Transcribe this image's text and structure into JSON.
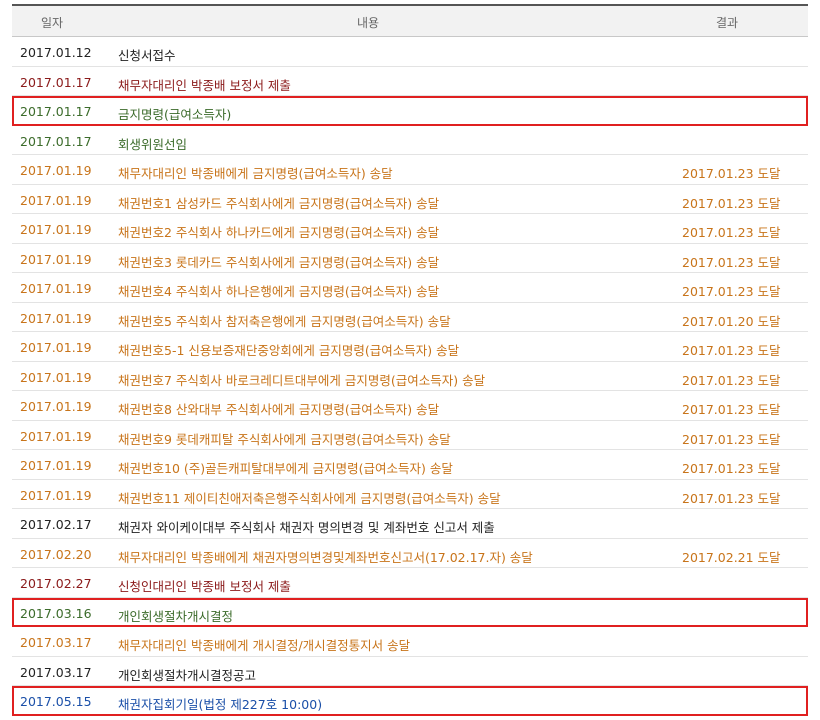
{
  "table": {
    "headers": {
      "date": "일자",
      "content": "내용",
      "result": "결과"
    },
    "colors": {
      "black": "#222222",
      "maroon": "#8b1a1a",
      "green": "#3b6b2a",
      "orange": "#c8741a",
      "blue": "#1a4fa8",
      "highlight_border": "#e02020"
    },
    "rows": [
      {
        "date": "2017.01.12",
        "content": "신청서접수",
        "result": "",
        "color": "#222222",
        "boxed": false
      },
      {
        "date": "2017.01.17",
        "content": "채무자대리인 박종배 보정서 제출",
        "result": "",
        "color": "#8b1a1a",
        "boxed": false
      },
      {
        "date": "2017.01.17",
        "content": "금지명령(급여소득자)",
        "result": "",
        "color": "#3b6b2a",
        "boxed": true
      },
      {
        "date": "2017.01.17",
        "content": "회생위원선임",
        "result": "",
        "color": "#3b6b2a",
        "boxed": false
      },
      {
        "date": "2017.01.19",
        "content": "채무자대리인 박종배에게 금지명령(급여소득자) 송달",
        "result": "2017.01.23 도달",
        "color": "#c8741a",
        "boxed": false
      },
      {
        "date": "2017.01.19",
        "content": "채권번호1 삼성카드 주식회사에게 금지명령(급여소득자) 송달",
        "result": "2017.01.23 도달",
        "color": "#c8741a",
        "boxed": false
      },
      {
        "date": "2017.01.19",
        "content": "채권번호2 주식회사 하나카드에게 금지명령(급여소득자) 송달",
        "result": "2017.01.23 도달",
        "color": "#c8741a",
        "boxed": false
      },
      {
        "date": "2017.01.19",
        "content": "채권번호3 롯데카드 주식회사에게 금지명령(급여소득자) 송달",
        "result": "2017.01.23 도달",
        "color": "#c8741a",
        "boxed": false
      },
      {
        "date": "2017.01.19",
        "content": "채권번호4 주식회사 하나은행에게 금지명령(급여소득자) 송달",
        "result": "2017.01.23 도달",
        "color": "#c8741a",
        "boxed": false
      },
      {
        "date": "2017.01.19",
        "content": "채권번호5 주식회사 참저축은행에게 금지명령(급여소득자) 송달",
        "result": "2017.01.20 도달",
        "color": "#c8741a",
        "boxed": false
      },
      {
        "date": "2017.01.19",
        "content": "채권번호5-1 신용보증재단중앙회에게 금지명령(급여소득자) 송달",
        "result": "2017.01.23 도달",
        "color": "#c8741a",
        "boxed": false
      },
      {
        "date": "2017.01.19",
        "content": "채권번호7 주식회사 바로크레디트대부에게 금지명령(급여소득자) 송달",
        "result": "2017.01.23 도달",
        "color": "#c8741a",
        "boxed": false
      },
      {
        "date": "2017.01.19",
        "content": "채권번호8 산와대부 주식회사에게 금지명령(급여소득자) 송달",
        "result": "2017.01.23 도달",
        "color": "#c8741a",
        "boxed": false
      },
      {
        "date": "2017.01.19",
        "content": "채권번호9 롯데캐피탈 주식회사에게 금지명령(급여소득자) 송달",
        "result": "2017.01.23 도달",
        "color": "#c8741a",
        "boxed": false
      },
      {
        "date": "2017.01.19",
        "content": "채권번호10 (주)골든캐피탈대부에게 금지명령(급여소득자) 송달",
        "result": "2017.01.23 도달",
        "color": "#c8741a",
        "boxed": false
      },
      {
        "date": "2017.01.19",
        "content": "채권번호11 제이티친애저축은행주식회사에게 금지명령(급여소득자) 송달",
        "result": "2017.01.23 도달",
        "color": "#c8741a",
        "boxed": false
      },
      {
        "date": "2017.02.17",
        "content": "채권자 와이케이대부 주식회사 채권자 명의변경 및 계좌번호 신고서 제출",
        "result": "",
        "color": "#222222",
        "boxed": false
      },
      {
        "date": "2017.02.20",
        "content": "채무자대리인 박종배에게 채권자명의변경및계좌번호신고서(17.02.17.자) 송달",
        "result": "2017.02.21 도달",
        "color": "#c8741a",
        "boxed": false
      },
      {
        "date": "2017.02.27",
        "content": "신청인대리인 박종배 보정서 제출",
        "result": "",
        "color": "#8b1a1a",
        "boxed": false
      },
      {
        "date": "2017.03.16",
        "content": "개인회생절차개시결정",
        "result": "",
        "color": "#3b6b2a",
        "boxed": true
      },
      {
        "date": "2017.03.17",
        "content": "채무자대리인 박종배에게 개시결정/개시결정통지서 송달",
        "result": "",
        "color": "#c8741a",
        "boxed": false
      },
      {
        "date": "2017.03.17",
        "content": "개인회생절차개시결정공고",
        "result": "",
        "color": "#222222",
        "boxed": false
      },
      {
        "date": "2017.05.15",
        "content": "채권자집회기일(법정 제227호 10:00)",
        "result": "",
        "color": "#1a4fa8",
        "boxed": true
      }
    ]
  }
}
